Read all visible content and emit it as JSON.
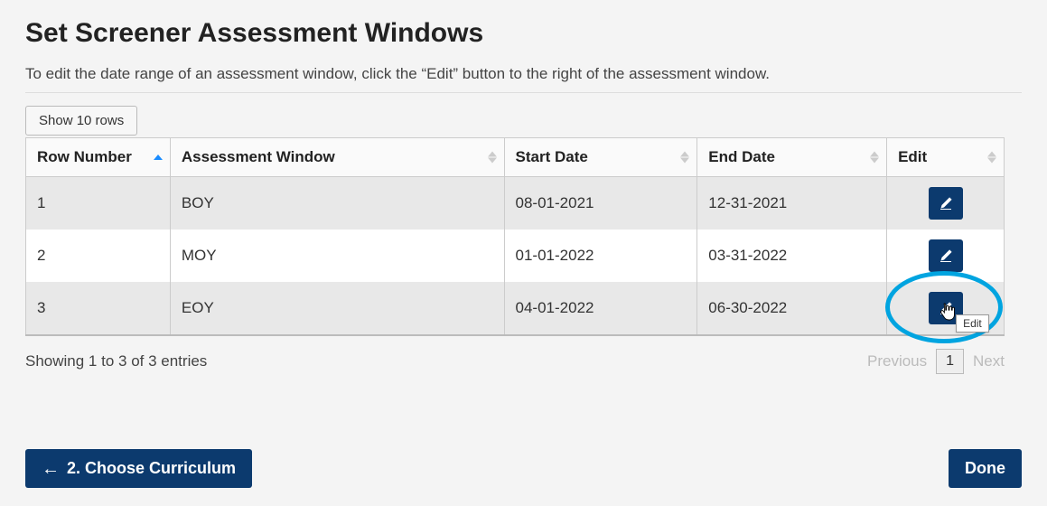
{
  "title": "Set Screener Assessment Windows",
  "instructions": "To edit the date range of an assessment window, click the “Edit” button to the right of the assessment window.",
  "show_rows_label": "Show 10 rows",
  "columns": {
    "row_number": "Row Number",
    "assessment_window": "Assessment Window",
    "start_date": "Start Date",
    "end_date": "End Date",
    "edit": "Edit"
  },
  "rows": [
    {
      "num": "1",
      "window": "BOY",
      "start": "08-01-2021",
      "end": "12-31-2021"
    },
    {
      "num": "2",
      "window": "MOY",
      "start": "01-01-2022",
      "end": "03-31-2022"
    },
    {
      "num": "3",
      "window": "EOY",
      "start": "04-01-2022",
      "end": "06-30-2022"
    }
  ],
  "entries_info": "Showing 1 to 3 of 3 entries",
  "pager": {
    "previous": "Previous",
    "page": "1",
    "next": "Next"
  },
  "tooltip_edit": "Edit",
  "footer": {
    "back_label": "2. Choose Curriculum",
    "done_label": "Done"
  }
}
